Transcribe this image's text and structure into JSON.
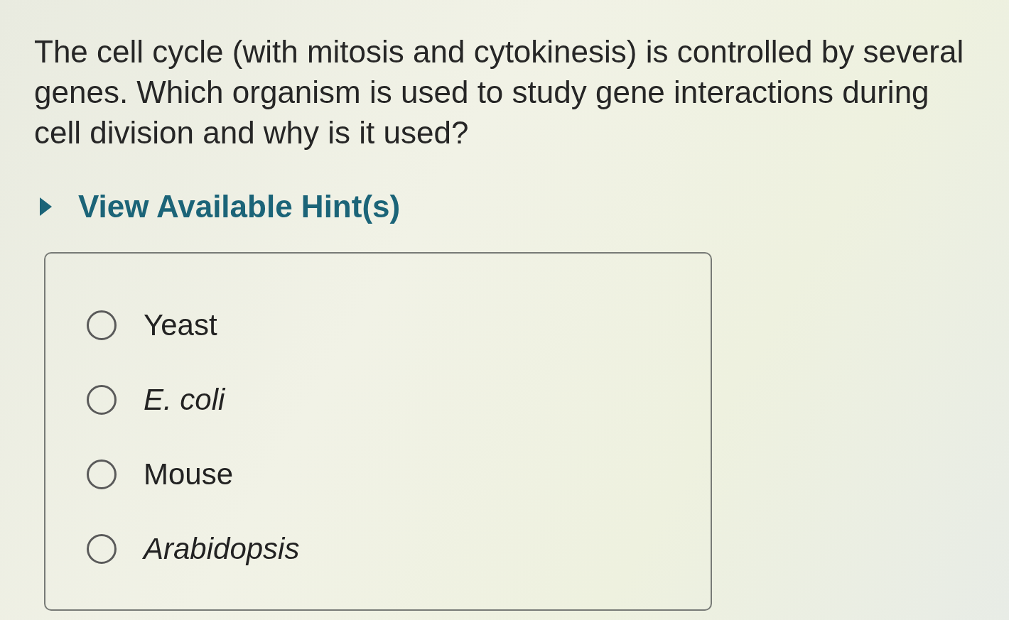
{
  "question": {
    "text": "The cell cycle (with mitosis and cytokinesis) is controlled by several genes. Which organism is used to study gene interactions during cell division and why is it used?"
  },
  "hint": {
    "label": "View Available Hint(s)",
    "expanded": false
  },
  "options": [
    {
      "label": "Yeast",
      "italic": false,
      "selected": false
    },
    {
      "label": "E. coli",
      "italic": true,
      "selected": false
    },
    {
      "label": "Mouse",
      "italic": false,
      "selected": false
    },
    {
      "label": "Arabidopsis",
      "italic": true,
      "selected": false
    }
  ]
}
